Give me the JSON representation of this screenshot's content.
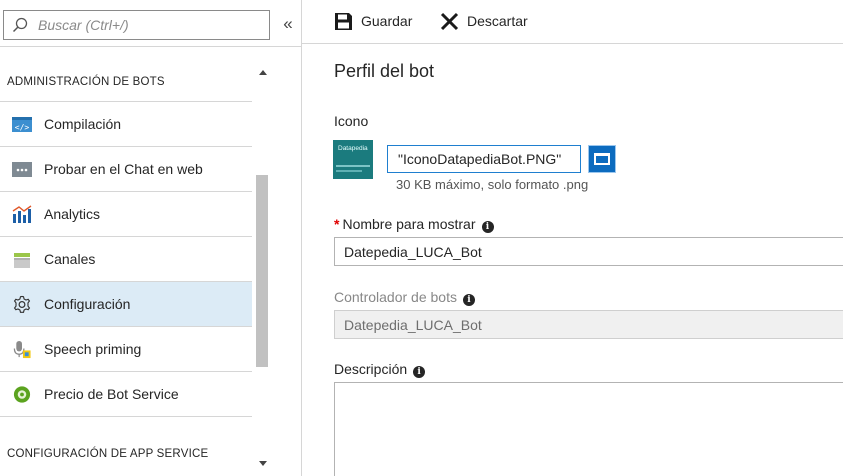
{
  "search": {
    "placeholder": "Buscar (Ctrl+/)"
  },
  "collapse_glyph": "«",
  "sidebar": {
    "section_1": "ADMINISTRACIÓN DE BOTS",
    "items": [
      {
        "label": "Compilación",
        "icon": "code-icon"
      },
      {
        "label": "Probar en el Chat en web",
        "icon": "chat-icon"
      },
      {
        "label": "Analytics",
        "icon": "analytics-icon"
      },
      {
        "label": "Canales",
        "icon": "channels-icon"
      },
      {
        "label": "Configuración",
        "icon": "gear-icon",
        "active": true
      },
      {
        "label": "Speech priming",
        "icon": "microphone-icon"
      },
      {
        "label": "Precio de Bot Service",
        "icon": "pricing-icon"
      }
    ],
    "section_2": "CONFIGURACIÓN DE APP SERVICE"
  },
  "toolbar": {
    "save_label": "Guardar",
    "discard_label": "Descartar"
  },
  "main": {
    "title": "Perfil del bot",
    "icon_label": "Icono",
    "thumbnail_text": "Datapedia",
    "file_name": "\"IconoDatapediaBot.PNG\"",
    "file_hint": "30 KB máximo, solo formato .png",
    "required_mark": "*",
    "display_name_label": "Nombre para mostrar",
    "display_name_value": "Datepedia_LUCA_Bot",
    "controller_label": "Controlador de bots",
    "controller_value": "Datepedia_LUCA_Bot",
    "description_label": "Descripción",
    "description_value": "",
    "info_glyph": "i"
  },
  "colors": {
    "accent": "#0c6bbf",
    "active_row": "#dcebf6",
    "required": "#e00000",
    "thumbnail_bg": "#1b7b7e"
  }
}
